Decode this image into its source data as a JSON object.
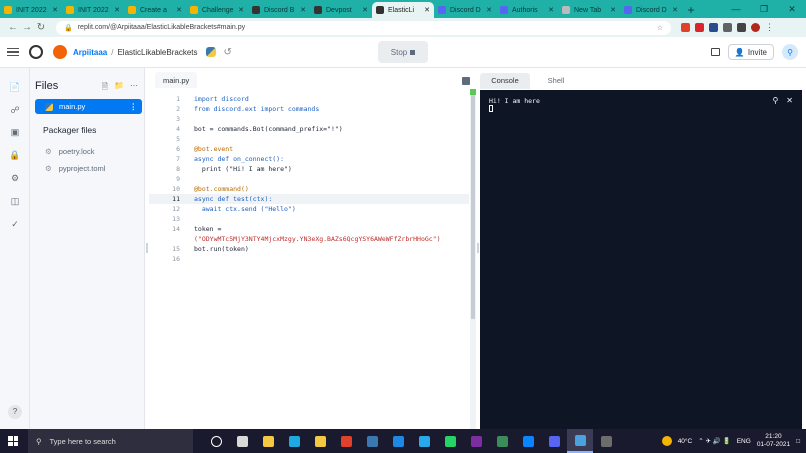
{
  "browser": {
    "tabs": [
      {
        "label": "INIT 2022",
        "color": "#f5b400"
      },
      {
        "label": "INIT 2022",
        "color": "#f5b400"
      },
      {
        "label": "Create a",
        "color": "#f5b400"
      },
      {
        "label": "Challenge",
        "color": "#f5b400"
      },
      {
        "label": "Discord B",
        "color": "#333333"
      },
      {
        "label": "Devpost",
        "color": "#333333"
      },
      {
        "label": "ElasticLi",
        "color": "#333333",
        "active": true
      },
      {
        "label": "Discord D",
        "color": "#5865f2"
      },
      {
        "label": "Authoris",
        "color": "#5865f2"
      },
      {
        "label": "New Tab",
        "color": "#bbbbbb"
      },
      {
        "label": "Discord D",
        "color": "#5865f2"
      }
    ],
    "new_tab": "+",
    "window_controls": [
      "—",
      "❐",
      "✕"
    ],
    "url": "replit.com/@Arpiitaaa/ElasticLikableBrackets#main.py"
  },
  "header": {
    "username": "Arpiitaaa",
    "separator": "/",
    "repl_name": "ElasticLikableBrackets",
    "stop_label": "Stop",
    "invite_label": "Invite"
  },
  "files_panel": {
    "title": "Files",
    "files": [
      {
        "name": "main.py",
        "selected": true
      }
    ],
    "packager_title": "Packager files",
    "packager_files": [
      "poetry.lock",
      "pyproject.toml"
    ]
  },
  "editor": {
    "tab_label": "main.py",
    "current_line": 11,
    "line_numbers": [
      "1",
      "2",
      "3",
      "4",
      "5",
      "6",
      "7",
      "8",
      "9",
      "10",
      "11",
      "12",
      "13",
      "14",
      "",
      "15",
      "16"
    ],
    "lines": [
      "import discord",
      "from discord.ext import commands",
      "",
      "bot = commands.Bot(command_prefix=\"!\")",
      "",
      "@bot.event",
      "async def on_connect():",
      "  print (\"Hi! I am here\")",
      "",
      "@bot.command()",
      "async def test(ctx):",
      "  await ctx.send (\"Hello\")",
      "",
      "token =",
      "(\"ODYwMTc5MjY3NTY4MjcxMzgy.YN3eXg.BAZs6QcgYSY6AWeWFfZrbrHHoGc\")",
      "bot.run(token)",
      ""
    ]
  },
  "console": {
    "tabs": [
      "Console",
      "Shell"
    ],
    "output": "Hi! I am here"
  },
  "taskbar": {
    "search_placeholder": "Type here to search",
    "weather": "40°C",
    "language": "ENG",
    "time": "21:20",
    "date": "01-07-2021"
  }
}
